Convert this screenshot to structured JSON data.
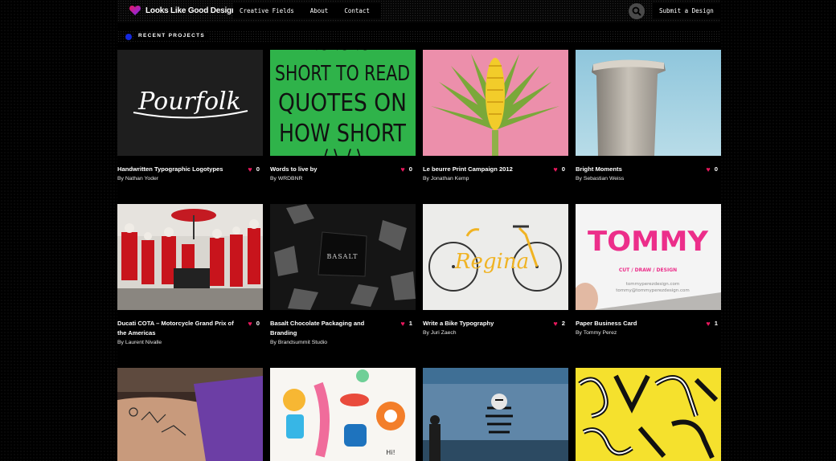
{
  "site": {
    "name": "Looks Like Good Design"
  },
  "nav": {
    "items": [
      "Creative Fields",
      "About",
      "Contact"
    ]
  },
  "header": {
    "submit_label": "Submit a Design"
  },
  "section": {
    "title": "RECENT PROJECTS"
  },
  "colors": {
    "heart": "#e8185d",
    "section_dot": "#1428e0",
    "background": "#000000"
  },
  "projects": [
    {
      "title": "Handwritten Typographic Logotypes",
      "author": "By Nathan Yoder",
      "likes": "0"
    },
    {
      "title": "Words to live by",
      "author": "By WRDBNR",
      "likes": "0"
    },
    {
      "title": "Le beurre Print Campaign 2012",
      "author": "By Jonathan Kemp",
      "likes": "0"
    },
    {
      "title": "Bright Moments",
      "author": "By Sebastian Weiss",
      "likes": "0"
    },
    {
      "title": "Ducati COTA – Motorcycle Grand Prix of the Americas",
      "author": "By Laurent Nivalle",
      "likes": "0"
    },
    {
      "title": "Basalt Chocolate Packaging and Branding",
      "author": "By Brandsummit Studio",
      "likes": "1"
    },
    {
      "title": "Write a Bike Typography",
      "author": "By Juri Zaech",
      "likes": "2"
    },
    {
      "title": "Paper Business Card",
      "author": "By Tommy Perez",
      "likes": "1"
    }
  ],
  "thumb_text": {
    "p1_logo": "Pourfolk",
    "p2_lines": [
      "SHORT TO READ",
      "QUOTES ON",
      "HOW SHORT"
    ],
    "p6_brand": "BASALT",
    "p7_word": "Regina",
    "p8_logo": "TOMMY",
    "p8_sub": "CUT / DRAW / DESIGN",
    "p8_web": "tommyperezdesign.com",
    "p8_mail": "tommy@tommyperezdesign.com",
    "p10_hi": "Hi!"
  }
}
